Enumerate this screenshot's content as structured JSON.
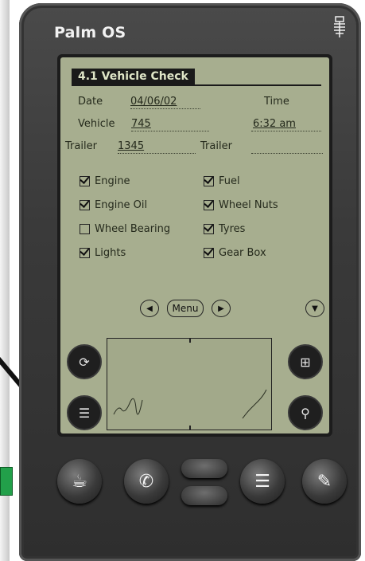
{
  "device": {
    "brand": "Palm OS"
  },
  "app": {
    "title": "4.1 Vehicle Check",
    "fields": {
      "date_label": "Date",
      "date_value": "04/06/02",
      "time_label": "Time",
      "time_value": "6:32 am",
      "vehicle_label": "Vehicle",
      "vehicle_value": "745",
      "trailer1_label": "Trailer",
      "trailer1_value": "1345",
      "trailer2_label": "Trailer",
      "trailer2_value": ""
    },
    "checks": [
      {
        "label": "Engine",
        "checked": true
      },
      {
        "label": "Fuel",
        "checked": true
      },
      {
        "label": "Engine Oil",
        "checked": true
      },
      {
        "label": "Wheel Nuts",
        "checked": true
      },
      {
        "label": "Wheel Bearing",
        "checked": false
      },
      {
        "label": "Tyres",
        "checked": true
      },
      {
        "label": "Lights",
        "checked": true
      },
      {
        "label": "Gear Box",
        "checked": true
      }
    ],
    "nav": {
      "menu_label": "Menu"
    }
  }
}
